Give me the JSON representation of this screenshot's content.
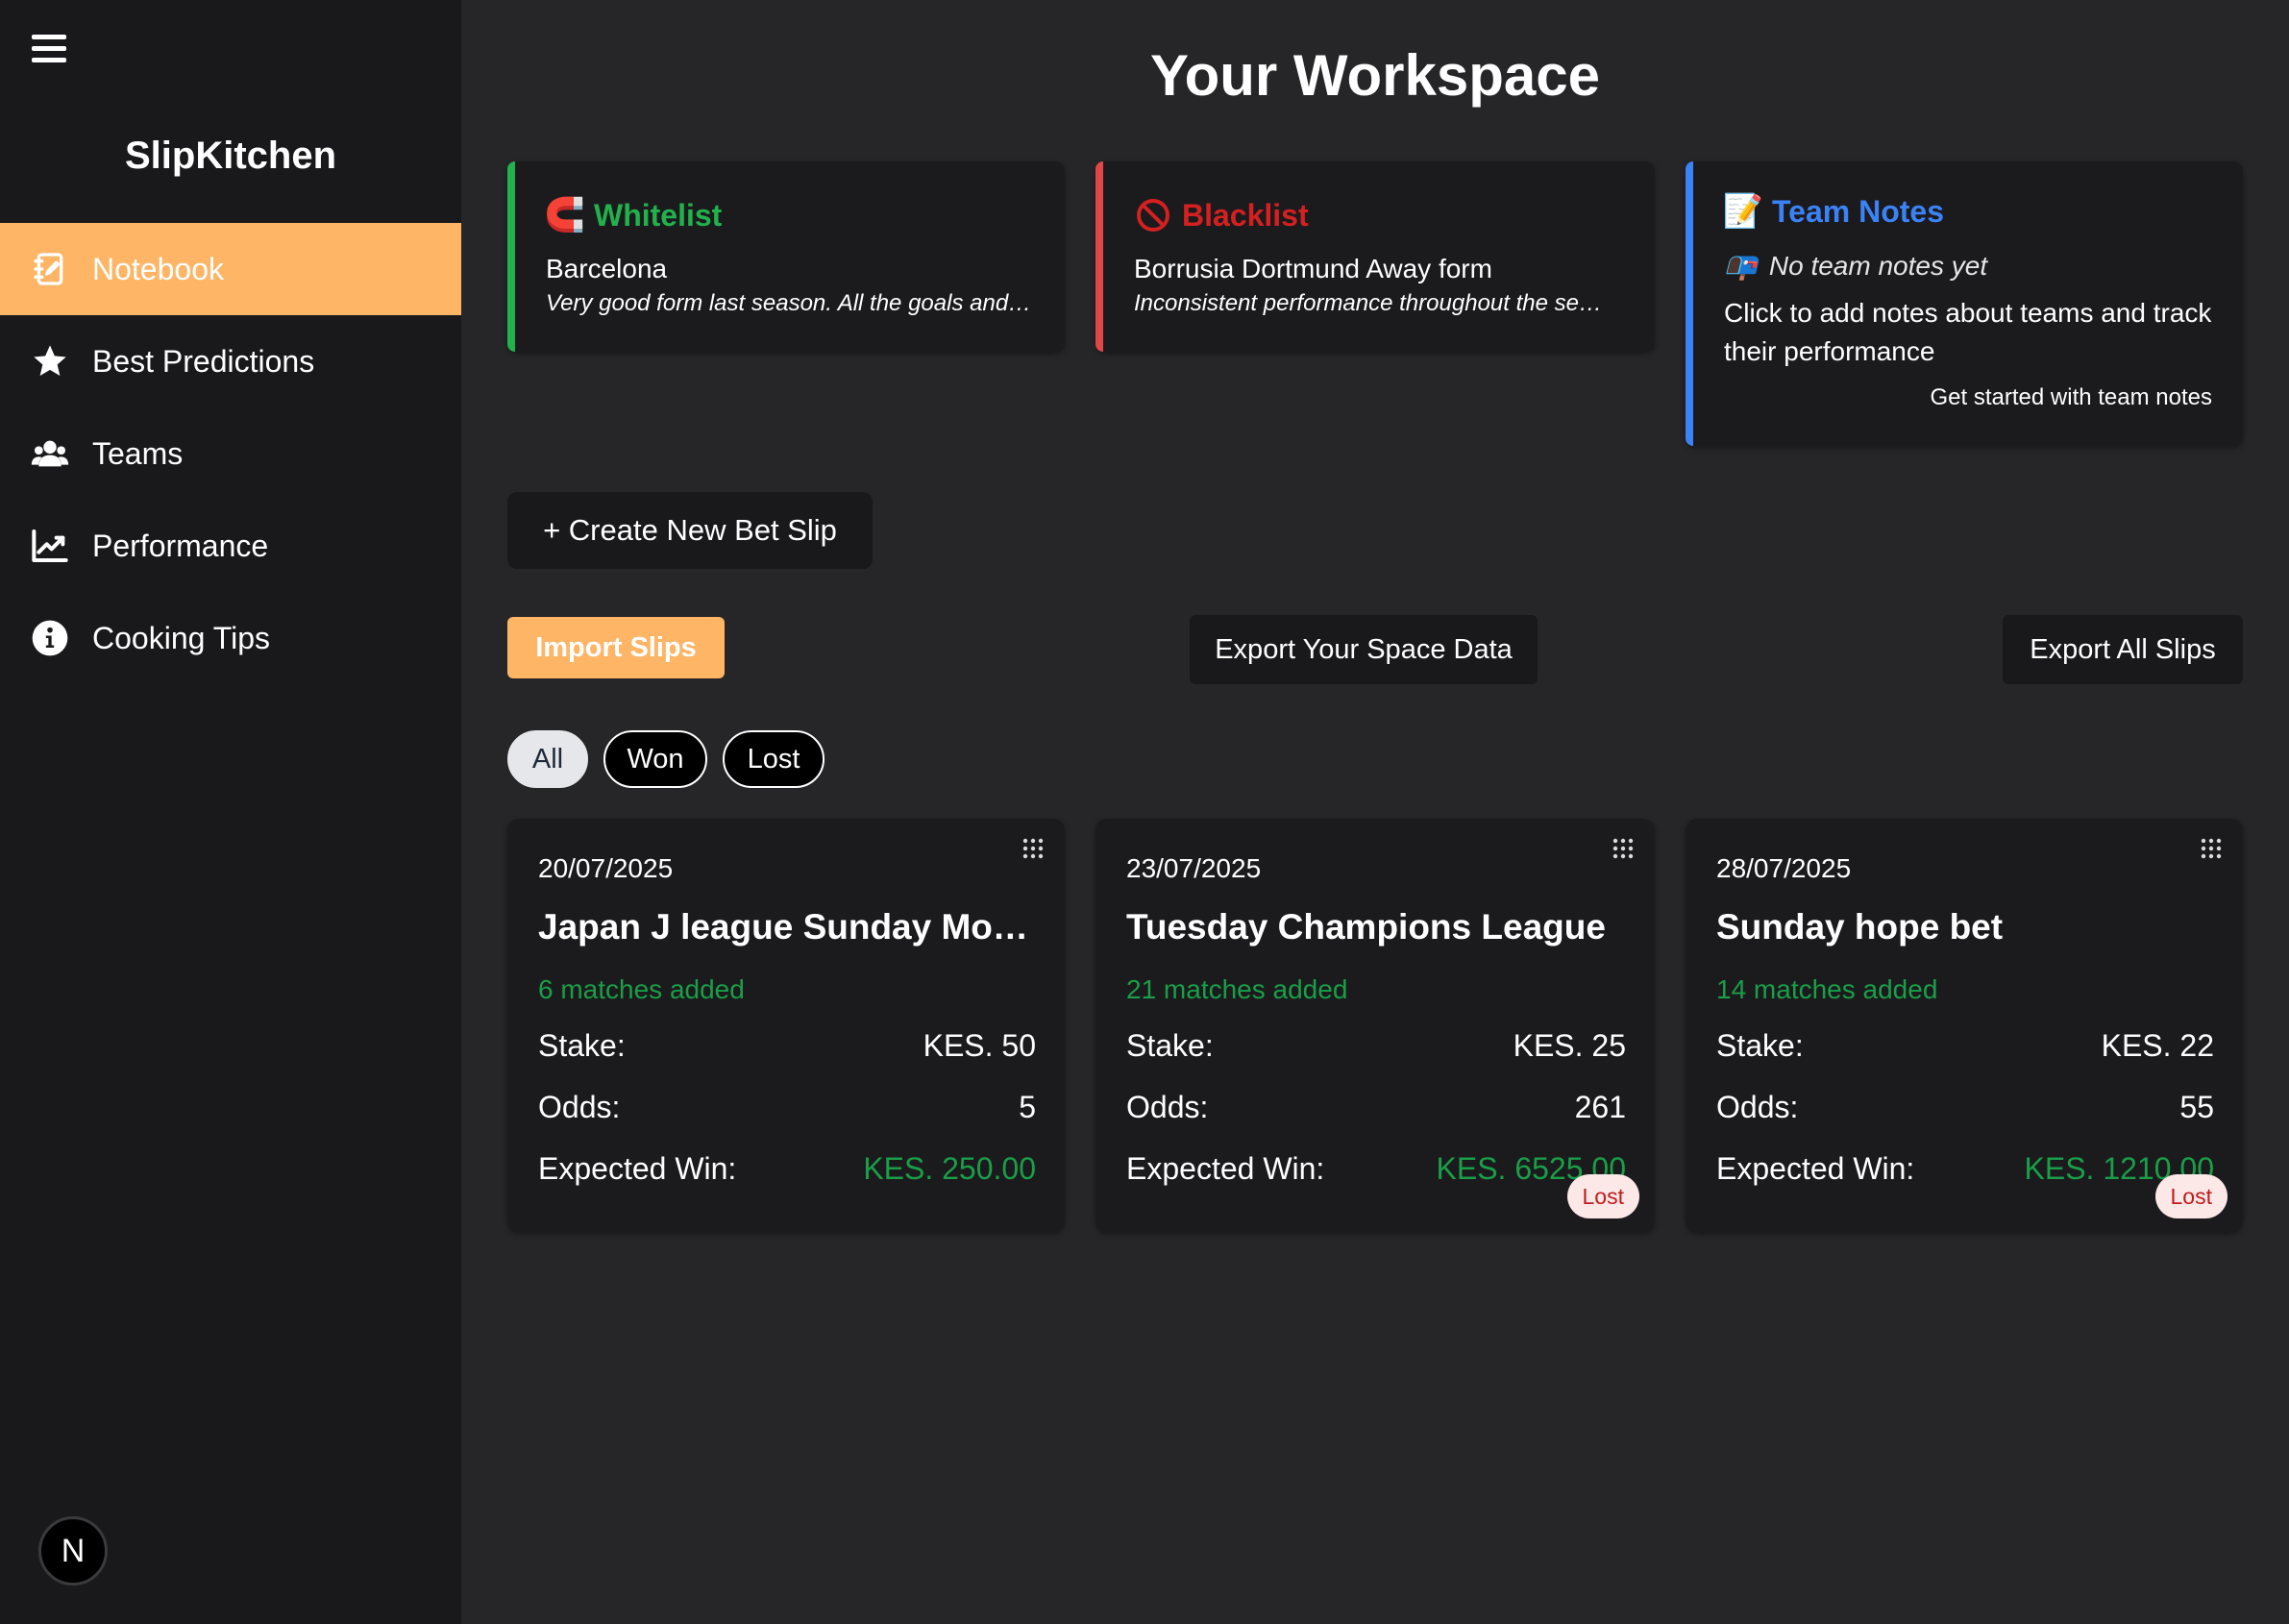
{
  "sidebar": {
    "brand": "SlipKitchen",
    "items": [
      {
        "label": "Notebook",
        "icon": "notebook-icon",
        "active": true
      },
      {
        "label": "Best Predictions",
        "icon": "star-icon",
        "active": false
      },
      {
        "label": "Teams",
        "icon": "team-icon",
        "active": false
      },
      {
        "label": "Performance",
        "icon": "chart-icon",
        "active": false
      },
      {
        "label": "Cooking Tips",
        "icon": "info-icon",
        "active": false
      }
    ],
    "avatar_letter": "N"
  },
  "header": {
    "title": "Your Workspace"
  },
  "panels": {
    "whitelist": {
      "icon": "🧲",
      "title": "Whitelist",
      "team": "Barcelona",
      "note": "Very good form last season. All the goals and assists",
      "color": "#22b14c"
    },
    "blacklist": {
      "icon": "🚫",
      "title": "Blacklist",
      "team": "Borrusia Dortmund Away form",
      "note": "Inconsistent performance throughout the season",
      "color": "#d42020"
    },
    "team_notes": {
      "icon": "📝",
      "title": "Team Notes",
      "empty_icon": "📭",
      "empty_text": "No team notes yet",
      "description": "Click to add notes about teams and track their performance",
      "cta": "Get started with team notes",
      "color": "#3b82f6"
    }
  },
  "actions": {
    "create": "+ Create New Bet Slip",
    "import": "Import Slips",
    "export_space": "Export Your Space Data",
    "export_all": "Export All Slips"
  },
  "filters": {
    "all": "All",
    "won": "Won",
    "lost": "Lost",
    "selected": "All"
  },
  "labels": {
    "stake": "Stake:",
    "odds": "Odds:",
    "expected": "Expected Win:"
  },
  "slips": [
    {
      "date": "20/07/2025",
      "title": "Japan J league Sunday Morning",
      "matches": "6 matches added",
      "stake": "KES. 50",
      "odds": "5",
      "expected": "KES. 250.00",
      "status": ""
    },
    {
      "date": "23/07/2025",
      "title": "Tuesday Champions League",
      "matches": "21 matches added",
      "stake": "KES. 25",
      "odds": "261",
      "expected": "KES. 6525.00",
      "status": "Lost"
    },
    {
      "date": "28/07/2025",
      "title": "Sunday hope bet",
      "matches": "14 matches added",
      "stake": "KES. 22",
      "odds": "55",
      "expected": "KES. 1210.00",
      "status": "Lost"
    }
  ]
}
